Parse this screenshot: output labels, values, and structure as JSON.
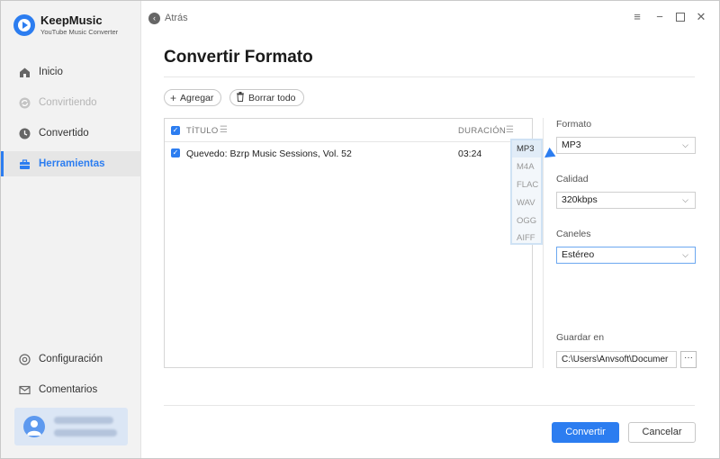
{
  "app": {
    "name": "KeepMusic",
    "subtitle": "YouTube Music Converter"
  },
  "sidebar": {
    "items": [
      {
        "label": "Inicio",
        "icon": "home-icon",
        "state": "normal"
      },
      {
        "label": "Convirtiendo",
        "icon": "sync-icon",
        "state": "disabled"
      },
      {
        "label": "Convertido",
        "icon": "clock-icon",
        "state": "normal"
      },
      {
        "label": "Herramientas",
        "icon": "toolbox-icon",
        "state": "active"
      }
    ],
    "bottom_items": [
      {
        "label": "Configuración",
        "icon": "gear-icon"
      },
      {
        "label": "Comentarios",
        "icon": "mail-icon"
      }
    ]
  },
  "header": {
    "back_label": "Atrás"
  },
  "main": {
    "title": "Convertir Formato",
    "toolbar": {
      "add_label": "Agregar",
      "clear_label": "Borrar todo"
    },
    "list": {
      "columns": {
        "title": "TÍTULO",
        "duration": "DURACIÓN"
      },
      "rows": [
        {
          "title": "Quevedo: Bzrp Music Sessions, Vol. 52",
          "duration": "03:24",
          "checked": true
        }
      ],
      "format_options": [
        "MP3",
        "M4A",
        "FLAC",
        "WAV",
        "OGG",
        "AIFF"
      ],
      "format_selected": "MP3"
    }
  },
  "settings": {
    "format_label": "Formato",
    "format_value": "MP3",
    "quality_label": "Calidad",
    "quality_value": "320kbps",
    "channels_label": "Caneles",
    "channels_value": "Estéreo",
    "save_label": "Guardar en",
    "save_path": "C:\\Users\\Anvsoft\\Documer",
    "browse_label": "···"
  },
  "footer": {
    "convert_label": "Convertir",
    "cancel_label": "Cancelar"
  },
  "colors": {
    "accent": "#2c7df0",
    "sidebar_bg": "#f2f2f2"
  }
}
